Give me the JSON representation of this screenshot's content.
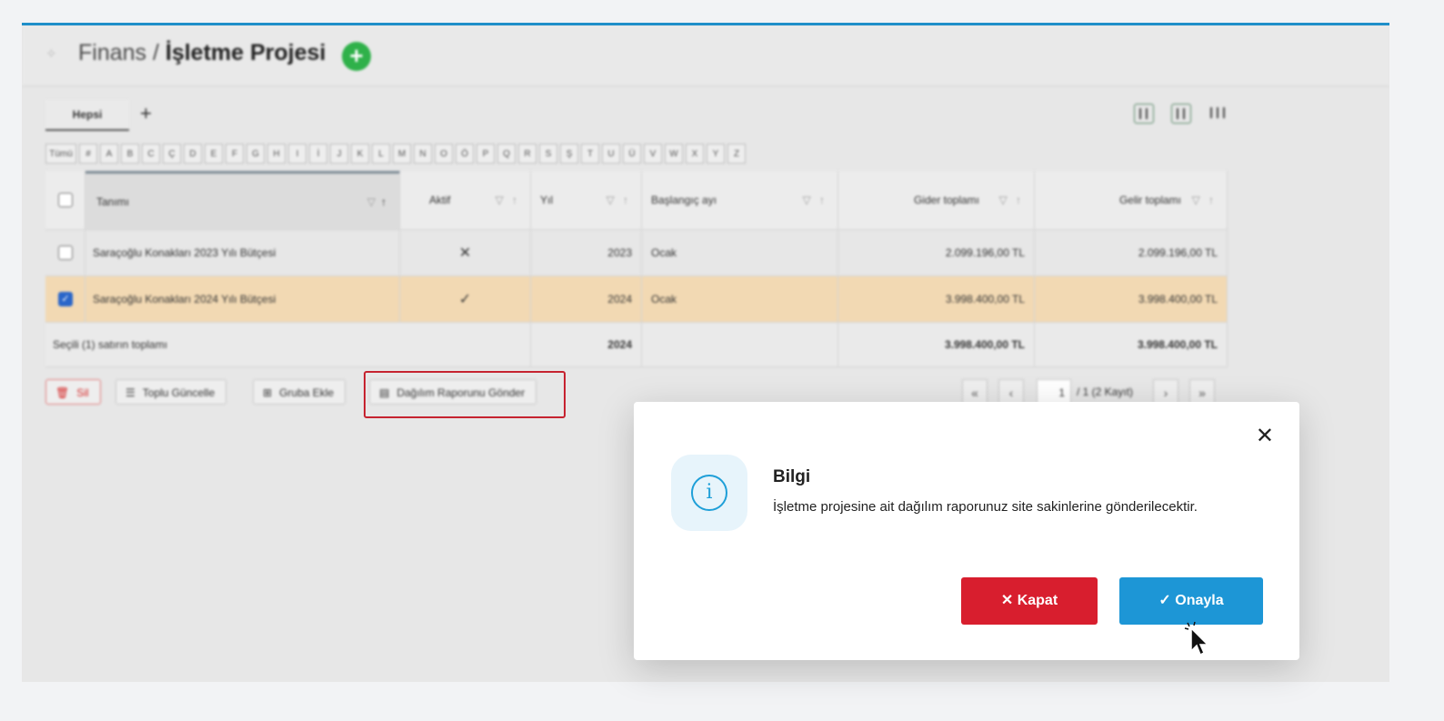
{
  "header": {
    "breadcrumb_section": "Finans /",
    "page_title": "İşletme Projesi"
  },
  "tabs": [
    {
      "label": "Hepsi"
    }
  ],
  "letters": [
    "Tümü",
    "#",
    "A",
    "B",
    "C",
    "Ç",
    "D",
    "E",
    "F",
    "G",
    "H",
    "I",
    "İ",
    "J",
    "K",
    "L",
    "M",
    "N",
    "O",
    "Ö",
    "P",
    "Q",
    "R",
    "S",
    "Ş",
    "T",
    "U",
    "Ü",
    "V",
    "W",
    "X",
    "Y",
    "Z"
  ],
  "table": {
    "columns": [
      "Tanımı",
      "Aktif",
      "Yıl",
      "Başlangıç ayı",
      "Gider toplamı",
      "Gelir toplamı"
    ],
    "rows": [
      {
        "name": "Saraçoğlu Konakları 2023 Yılı Bütçesi",
        "active": "✕",
        "year": "2023",
        "month": "Ocak",
        "expense": "2.099.196,00 TL",
        "income": "2.099.196,00 TL",
        "selected": false
      },
      {
        "name": "Saraçoğlu Konakları 2024 Yılı Bütçesi",
        "active": "✓",
        "year": "2024",
        "month": "Ocak",
        "expense": "3.998.400,00 TL",
        "income": "3.998.400,00 TL",
        "selected": true
      }
    ],
    "summary": {
      "label": "Seçili (1) satırın toplamı",
      "year": "2024",
      "expense": "3.998.400,00 TL",
      "income": "3.998.400,00 TL"
    }
  },
  "actions": {
    "delete": "Sil",
    "bulk_update": "Toplu Güncelle",
    "add_group": "Gruba Ekle",
    "send_report": "Dağılım Raporunu Gönder"
  },
  "pager": {
    "first": "«",
    "prev": "‹",
    "page": "1",
    "info": "/ 1 (2 Kayıt)",
    "next": "›",
    "last": "»"
  },
  "modal": {
    "title": "Bilgi",
    "message": "İşletme projesine ait dağılım raporunuz site sakinlerine gönderilecektir.",
    "close_label": "Kapat",
    "confirm_label": "Onayla"
  },
  "colors": {
    "accent": "#1d96d6",
    "danger": "#d81e2e",
    "selected_row": "#f2d9b3",
    "add_green": "#2fb14a"
  }
}
